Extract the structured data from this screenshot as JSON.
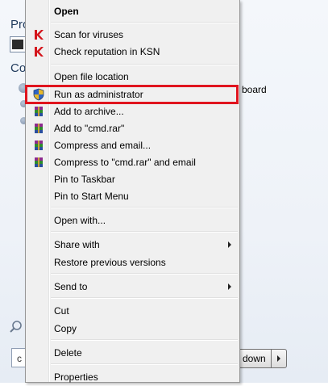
{
  "background": {
    "programs_label": "Pro",
    "computer_label": "Co",
    "right_item_text": "board",
    "search_box_text": "c",
    "shutdown_label": "down"
  },
  "menu": {
    "open": "Open",
    "scan_viruses": "Scan for viruses",
    "check_ksn": "Check reputation in KSN",
    "open_file_location": "Open file location",
    "run_as_admin": "Run as administrator",
    "add_to_archive": "Add to archive...",
    "add_to_cmd_rar": "Add to \"cmd.rar\"",
    "compress_email": "Compress and email...",
    "compress_cmd_email": "Compress to \"cmd.rar\" and email",
    "pin_taskbar": "Pin to Taskbar",
    "pin_start": "Pin to Start Menu",
    "open_with": "Open with...",
    "share_with": "Share with",
    "restore_versions": "Restore previous versions",
    "send_to": "Send to",
    "cut": "Cut",
    "copy": "Copy",
    "delete": "Delete",
    "properties": "Properties"
  },
  "icons": {
    "kaspersky": "kaspersky-k-icon",
    "uac_shield": "uac-shield-icon",
    "winrar": "winrar-books-icon"
  },
  "colors": {
    "highlight_border": "#e0141e",
    "menu_background": "#f0f0f0"
  }
}
